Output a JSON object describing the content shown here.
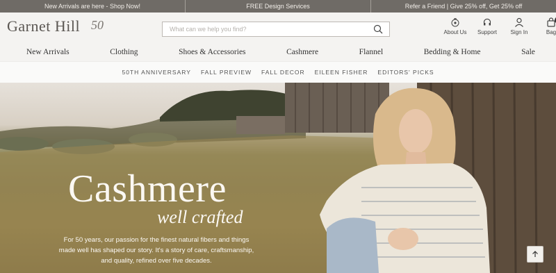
{
  "promo": [
    "New Arrivals are here - Shop Now!",
    "FREE Design Services",
    "Refer a Friend | Give 25% off, Get 25% off"
  ],
  "logo": {
    "text": "Garnet Hill",
    "badge": "50"
  },
  "search": {
    "placeholder": "What can we help you find?",
    "value": ""
  },
  "header_icons": [
    {
      "label": "About Us",
      "icon": "flower-icon"
    },
    {
      "label": "Support",
      "icon": "support-icon"
    },
    {
      "label": "Sign In",
      "icon": "user-icon"
    },
    {
      "label": "Bag",
      "icon": "bag-icon",
      "count": "0"
    }
  ],
  "main_nav": [
    "New Arrivals",
    "Clothing",
    "Shoes & Accessories",
    "Cashmere",
    "Flannel",
    "Bedding & Home",
    "Sale"
  ],
  "sub_nav": [
    "50TH ANNIVERSARY",
    "FALL PREVIEW",
    "FALL DECOR",
    "EILEEN FISHER",
    "EDITORS' PICKS"
  ],
  "hero": {
    "title": "Cashmere",
    "subtitle": "well crafted",
    "body": "For 50 years, our passion for the finest natural fibers and things made well has shaped our story. It's a story of care, craftsmanship, and quality, refined over five decades."
  },
  "colors": {
    "promo_bar": "#6f6b66",
    "header_bg": "#f4f3f1",
    "hero_text": "#fbf8f3"
  }
}
